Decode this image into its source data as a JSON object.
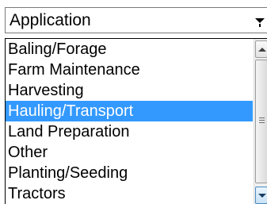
{
  "combo": {
    "value": "Application"
  },
  "dropdown": {
    "items": [
      {
        "label": "Baling/Forage"
      },
      {
        "label": "Farm Maintenance"
      },
      {
        "label": "Harvesting"
      },
      {
        "label": "Hauling/Transport"
      },
      {
        "label": "Land Preparation"
      },
      {
        "label": "Other"
      },
      {
        "label": "Planting/Seeding"
      },
      {
        "label": "Tractors"
      }
    ],
    "selected": "Hauling/Transport"
  },
  "colors": {
    "selection": "#3399ff",
    "selection_text": "#ffffff"
  },
  "icons": {
    "combo_arrow": "chevron-down-icon",
    "scroll_up": "scroll-up-arrow-icon",
    "scroll_down": "scroll-down-arrow-icon",
    "thumb_grip": "grip-icon"
  }
}
